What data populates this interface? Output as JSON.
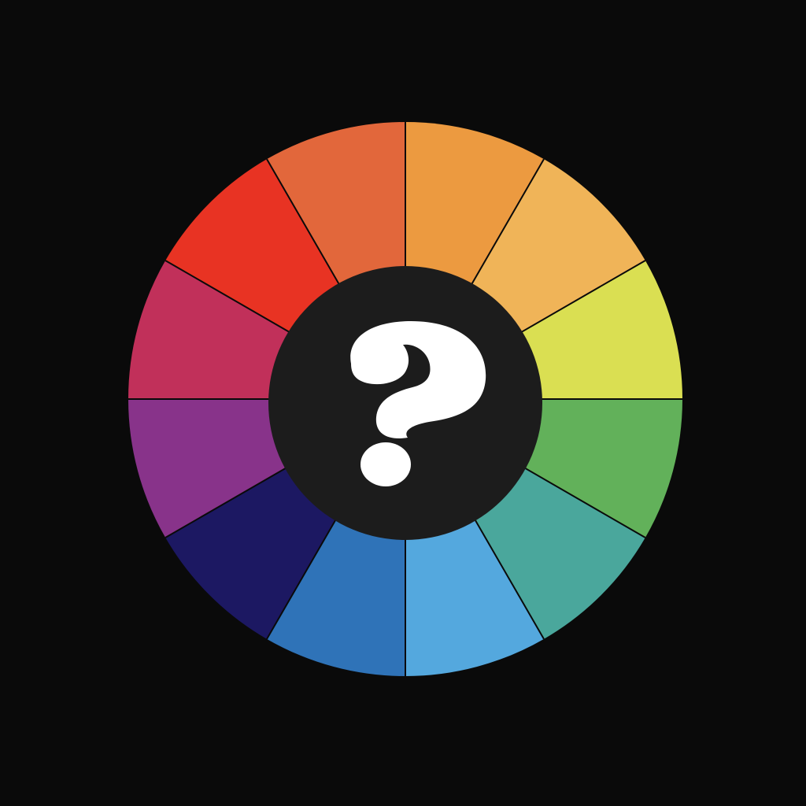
{
  "background_color": "#0a0a0a",
  "center_color": "#1c1c1c",
  "glyph_color": "#ffffff",
  "divider_color": "#0a0a0a",
  "segments": [
    {
      "name": "segment-orange",
      "color": "#ec9a40"
    },
    {
      "name": "segment-light-orange",
      "color": "#f0b458"
    },
    {
      "name": "segment-yellow-green",
      "color": "#dadf52"
    },
    {
      "name": "segment-green",
      "color": "#62b15a"
    },
    {
      "name": "segment-teal",
      "color": "#4aa79c"
    },
    {
      "name": "segment-light-blue",
      "color": "#54a8de"
    },
    {
      "name": "segment-blue",
      "color": "#2f73b8"
    },
    {
      "name": "segment-navy",
      "color": "#1c1862"
    },
    {
      "name": "segment-purple",
      "color": "#88338a"
    },
    {
      "name": "segment-crimson",
      "color": "#c1305a"
    },
    {
      "name": "segment-red",
      "color": "#e83323"
    },
    {
      "name": "segment-red-orange",
      "color": "#e2673b"
    }
  ],
  "center_icon": "question-mark-icon"
}
